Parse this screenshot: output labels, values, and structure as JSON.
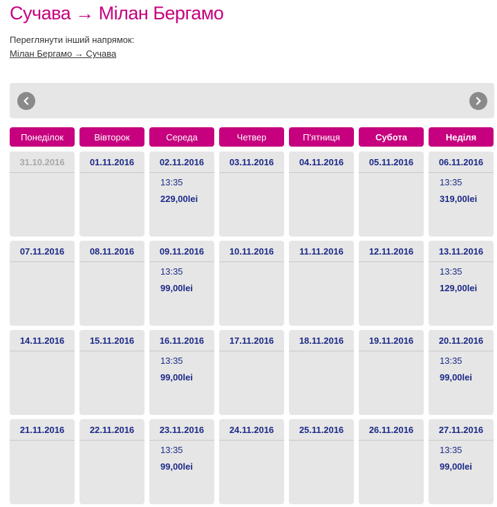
{
  "title": "Сучава → Мілан Бергамо",
  "other_direction": {
    "label": "Переглянути інший напрямок:",
    "link": "Мілан Бергамо → Сучава"
  },
  "nav": {
    "prev_icon": "chevron-left-icon",
    "next_icon": "chevron-right-icon"
  },
  "weekdays": [
    {
      "label": "Понеділок",
      "bold": false
    },
    {
      "label": "Вівторок",
      "bold": false
    },
    {
      "label": "Середа",
      "bold": false
    },
    {
      "label": "Четвер",
      "bold": false
    },
    {
      "label": "П'ятниця",
      "bold": false
    },
    {
      "label": "Субота",
      "bold": true
    },
    {
      "label": "Неділя",
      "bold": true
    }
  ],
  "weeks": [
    [
      {
        "date": "31.10.2016",
        "past": true
      },
      {
        "date": "01.11.2016"
      },
      {
        "date": "02.11.2016",
        "time": "13:35",
        "price": "229,00lei"
      },
      {
        "date": "03.11.2016"
      },
      {
        "date": "04.11.2016"
      },
      {
        "date": "05.11.2016"
      },
      {
        "date": "06.11.2016",
        "time": "13:35",
        "price": "319,00lei"
      }
    ],
    [
      {
        "date": "07.11.2016"
      },
      {
        "date": "08.11.2016"
      },
      {
        "date": "09.11.2016",
        "time": "13:35",
        "price": "99,00lei"
      },
      {
        "date": "10.11.2016"
      },
      {
        "date": "11.11.2016"
      },
      {
        "date": "12.11.2016"
      },
      {
        "date": "13.11.2016",
        "time": "13:35",
        "price": "129,00lei"
      }
    ],
    [
      {
        "date": "14.11.2016"
      },
      {
        "date": "15.11.2016"
      },
      {
        "date": "16.11.2016",
        "time": "13:35",
        "price": "99,00lei"
      },
      {
        "date": "17.11.2016"
      },
      {
        "date": "18.11.2016"
      },
      {
        "date": "19.11.2016"
      },
      {
        "date": "20.11.2016",
        "time": "13:35",
        "price": "99,00lei"
      }
    ],
    [
      {
        "date": "21.11.2016"
      },
      {
        "date": "22.11.2016"
      },
      {
        "date": "23.11.2016",
        "time": "13:35",
        "price": "99,00lei"
      },
      {
        "date": "24.11.2016"
      },
      {
        "date": "25.11.2016"
      },
      {
        "date": "26.11.2016"
      },
      {
        "date": "27.11.2016",
        "time": "13:35",
        "price": "99,00lei"
      }
    ]
  ],
  "colors": {
    "accent": "#c6007e",
    "date_text": "#1c2a87",
    "past_text": "#a8a8a8",
    "cell_bg": "#e6e6e6",
    "nav_button": "#8a8a8a"
  }
}
